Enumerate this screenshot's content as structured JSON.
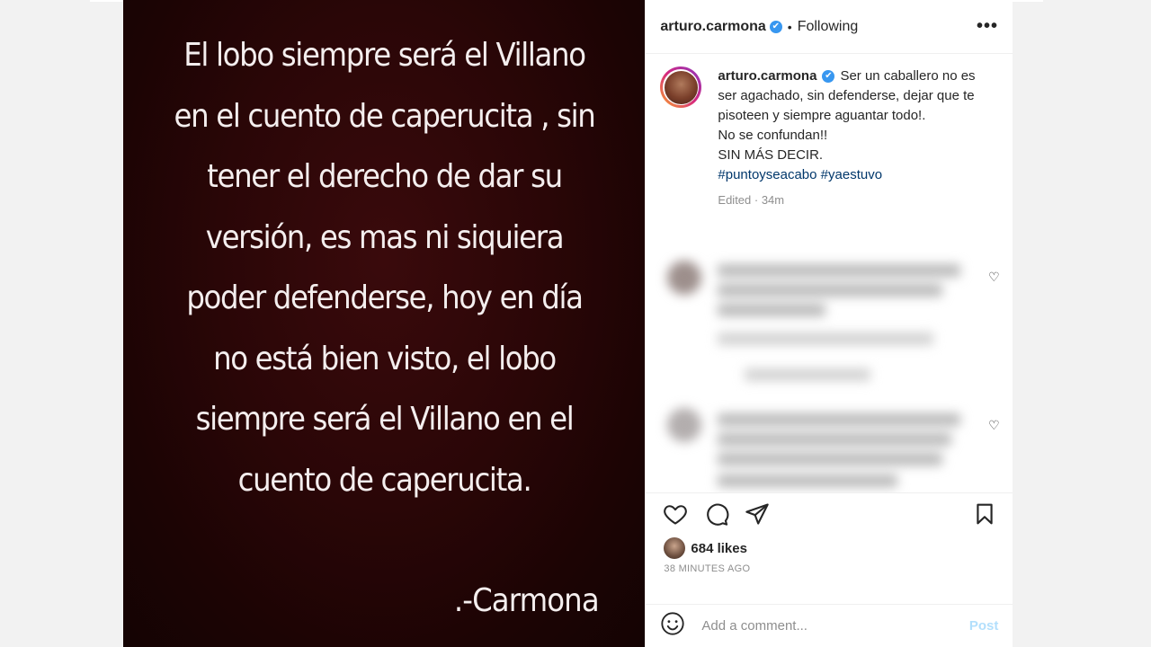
{
  "media": {
    "quote_lines": [
      "El lobo siempre será el Villano",
      "en el cuento de caperucita , sin",
      "tener el derecho de dar su",
      "versión, es mas ni siquiera",
      "poder defenderse, hoy en día",
      "no está bien visto, el lobo",
      "siempre será el Villano en el",
      "cuento de caperucita."
    ],
    "signature": ".-Carmona"
  },
  "header": {
    "username": "arturo.carmona",
    "verified_icon": "✔",
    "separator": "•",
    "follow_status": "Following",
    "more_icon": "•••"
  },
  "caption": {
    "username": "arturo.carmona",
    "verified_icon": "✔",
    "text_lines": [
      "Ser un caballero no es ser agachado, sin defenderse, dejar que te pisoteen y siempre aguantar todo!.",
      "No se confundan!!",
      "SIN MÁS DECIR."
    ],
    "hashtags": [
      "#puntoyseacabo",
      "#yaestuvo"
    ],
    "meta": "Edited · 34m"
  },
  "engagement": {
    "likes": "684 likes",
    "time": "38 MINUTES AGO"
  },
  "comment_bar": {
    "placeholder": "Add a comment...",
    "post_label": "Post"
  },
  "colors": {
    "media_bg": "#2a0607",
    "verified": "#3897f0",
    "hashtag": "#00376b",
    "post_button_disabled": "#b2dffc"
  }
}
